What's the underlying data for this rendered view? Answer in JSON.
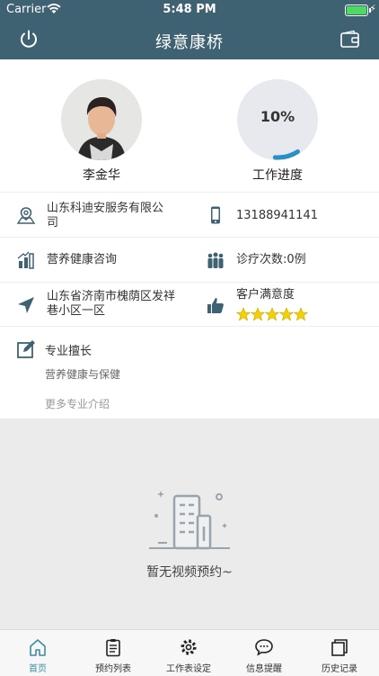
{
  "status_bar": {
    "carrier": "Carrier",
    "time": "5:48 PM"
  },
  "nav": {
    "title": "绿意康桥",
    "left_icon": "power-icon",
    "right_icon": "wallet-icon"
  },
  "profile": {
    "name": "李金华",
    "progress_text": "10%",
    "progress_value": 0.1,
    "progress_label": "工作进度"
  },
  "info": {
    "company": "山东科迪安服务有限公司",
    "phone": "13188941141",
    "service": "营养健康咨询",
    "treatments": "诊疗次数:0例",
    "address": "山东省济南市槐荫区发祥巷小区一区",
    "satisfaction_label": "客户满意度",
    "satisfaction_stars": 5
  },
  "specialty": {
    "title": "专业擅长",
    "description": "营养健康与保健",
    "more": "更多专业介绍"
  },
  "empty": {
    "message": "暂无视频预约~"
  },
  "tabs": [
    {
      "label": "首页",
      "icon": "home-icon",
      "active": true
    },
    {
      "label": "预约列表",
      "icon": "clipboard-icon",
      "active": false
    },
    {
      "label": "工作表设定",
      "icon": "gear-icon",
      "active": false
    },
    {
      "label": "信息提醒",
      "icon": "chat-icon",
      "active": false
    },
    {
      "label": "历史记录",
      "icon": "history-icon",
      "active": false
    }
  ],
  "colors": {
    "primary": "#3f6272",
    "accent": "#3f8ca0",
    "star": "#f5d000",
    "progress_arc": "#2a8fc4"
  }
}
